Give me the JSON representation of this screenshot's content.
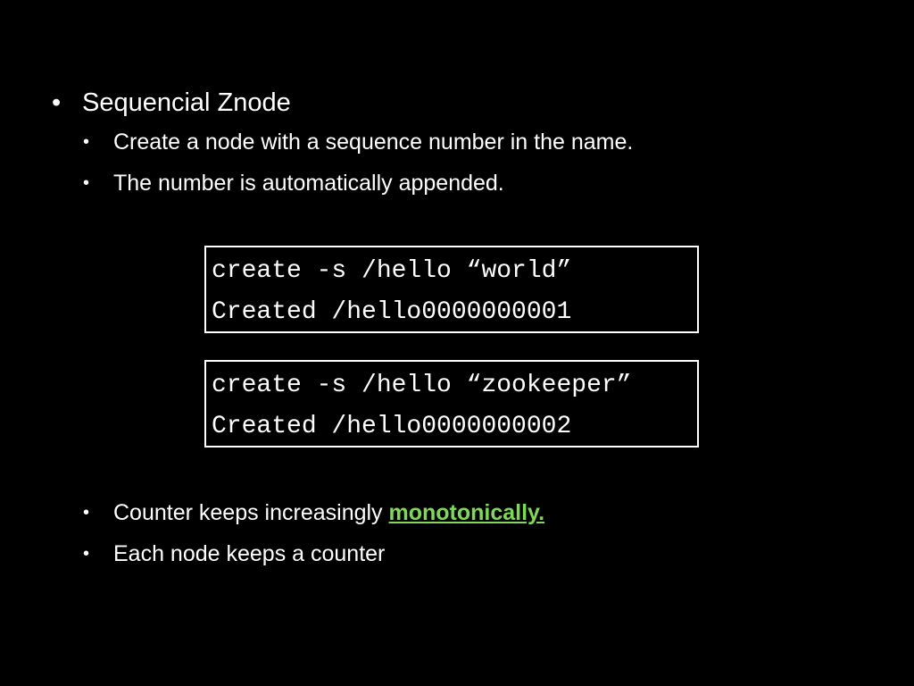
{
  "slide": {
    "bullet_glyph": "•",
    "title_bullet": "Sequencial Znode",
    "sub_bullets_top": [
      "Create a node with a sequence number in the name.",
      "The number is automatically appended."
    ],
    "code_boxes": [
      {
        "command": "create -s /hello “world”",
        "output": "Created /hello0000000001"
      },
      {
        "command": "create -s /hello “zookeeper”",
        "output": "Created /hello0000000002"
      }
    ],
    "sub_bullets_bottom": [
      {
        "text": "Counter keeps increasingly ",
        "highlight": "monotonically."
      },
      {
        "text": "Each node keeps a counter"
      }
    ],
    "colors": {
      "background": "#000000",
      "text": "#ffffff",
      "highlight": "#7ed957"
    }
  }
}
